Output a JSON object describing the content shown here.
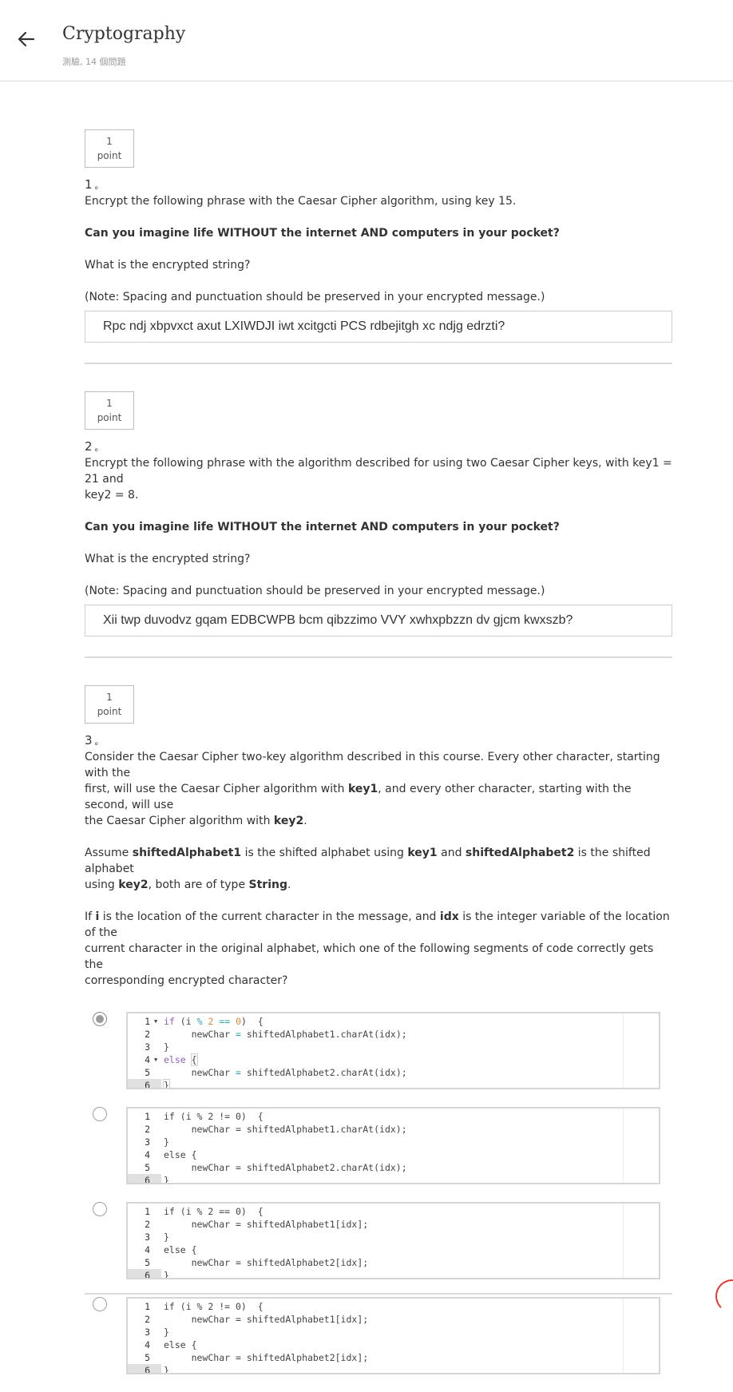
{
  "header": {
    "title": "Cryptography",
    "subtitle": "測驗, 14 個問題"
  },
  "questions": [
    {
      "points_value": "1",
      "points_unit": "point",
      "number": "1",
      "number_mark": "。",
      "prompt": "Encrypt the following phrase with the Caesar Cipher algorithm, using key 15.",
      "phrase": "Can you imagine life WITHOUT the internet AND computers in your pocket?",
      "ask": "What is the encrypted string?",
      "note": "(Note: Spacing and punctuation should be preserved in your encrypted message.)",
      "answer": "Rpc ndj xbpvxct axut LXIWDJI iwt xcitgcti PCS rdbejitgh xc ndjg edrzti?"
    },
    {
      "points_value": "1",
      "points_unit": "point",
      "number": "2",
      "number_mark": "。",
      "prompt_line1": "Encrypt the following phrase with the algorithm described for using two Caesar Cipher keys, with key1 = 21 and",
      "prompt_line2": "key2 = 8.",
      "phrase": "Can you imagine life WITHOUT the internet AND computers in your pocket?",
      "ask": "What is the encrypted string?",
      "note": "(Note: Spacing and punctuation should be preserved in your encrypted message.)",
      "answer": "Xii twp duvodvz gqam EDBCWPB bcm qibzzimo VVY xwhxpbzzn dv gjcm kwxszb?"
    },
    {
      "points_value": "1",
      "points_unit": "point",
      "number": "3",
      "number_mark": "。",
      "p1_a": "Consider the Caesar Cipher two-key algorithm described in this course. Every other character, starting with the",
      "p1_b": "first, will use the Caesar Cipher algorithm with ",
      "p1_b_key": "key1",
      "p1_c": ", and every other character, starting with the second, will use",
      "p1_d": "the Caesar Cipher algorithm with ",
      "p1_d_key": "key2",
      "p1_e": ".",
      "p2_a": "Assume ",
      "p2_b": "shiftedAlphabet1",
      "p2_c": " is the shifted alphabet using ",
      "p2_d": "key1",
      "p2_e": " and ",
      "p2_f": "shiftedAlphabet2",
      "p2_g": " is the shifted alphabet",
      "p2_h": "using ",
      "p2_i": "key2",
      "p2_j": ", both are of type ",
      "p2_k": "String",
      "p2_l": ".",
      "p3_a": "If ",
      "p3_b": "i",
      "p3_c": " is the location of the current character in the message, and ",
      "p3_d": "idx",
      "p3_e": " is the integer variable of the location of the",
      "p3_f": "current character in the original alphabet, which one of the following segments of code correctly gets the",
      "p3_g": "corresponding encrypted character?",
      "options": [
        {
          "selected": true,
          "lines": [
            {
              "n": "1",
              "text": "if (i % 2 == 0)  {"
            },
            {
              "n": "2",
              "text": "     newChar = shiftedAlphabet1.charAt(idx);"
            },
            {
              "n": "3",
              "text": "}"
            },
            {
              "n": "4",
              "text": "else {"
            },
            {
              "n": "5",
              "text": "     newChar = shiftedAlphabet2.charAt(idx);"
            },
            {
              "n": "6",
              "text": "}"
            }
          ]
        },
        {
          "selected": false,
          "lines": [
            {
              "n": "1",
              "text": "if (i % 2 != 0)  {"
            },
            {
              "n": "2",
              "text": "     newChar = shiftedAlphabet1.charAt(idx);"
            },
            {
              "n": "3",
              "text": "}"
            },
            {
              "n": "4",
              "text": "else {"
            },
            {
              "n": "5",
              "text": "     newChar = shiftedAlphabet2.charAt(idx);"
            },
            {
              "n": "6",
              "text": "}"
            }
          ]
        },
        {
          "selected": false,
          "lines": [
            {
              "n": "1",
              "text": "if (i % 2 == 0)  {"
            },
            {
              "n": "2",
              "text": "     newChar = shiftedAlphabet1[idx];"
            },
            {
              "n": "3",
              "text": "}"
            },
            {
              "n": "4",
              "text": "else {"
            },
            {
              "n": "5",
              "text": "     newChar = shiftedAlphabet2[idx];"
            },
            {
              "n": "6",
              "text": "}"
            }
          ]
        },
        {
          "selected": false,
          "lines": [
            {
              "n": "1",
              "text": "if (i % 2 != 0)  {"
            },
            {
              "n": "2",
              "text": "     newChar = shiftedAlphabet1[idx];"
            },
            {
              "n": "3",
              "text": "}"
            },
            {
              "n": "4",
              "text": "else {"
            },
            {
              "n": "5",
              "text": "     newChar = shiftedAlphabet2[idx];"
            },
            {
              "n": "6",
              "text": "}"
            }
          ]
        }
      ]
    }
  ],
  "colors": {
    "keyword": "#8f5fbf",
    "number": "#e08a3a",
    "operator": "#2aa0b0",
    "spinner": "#e53935"
  }
}
